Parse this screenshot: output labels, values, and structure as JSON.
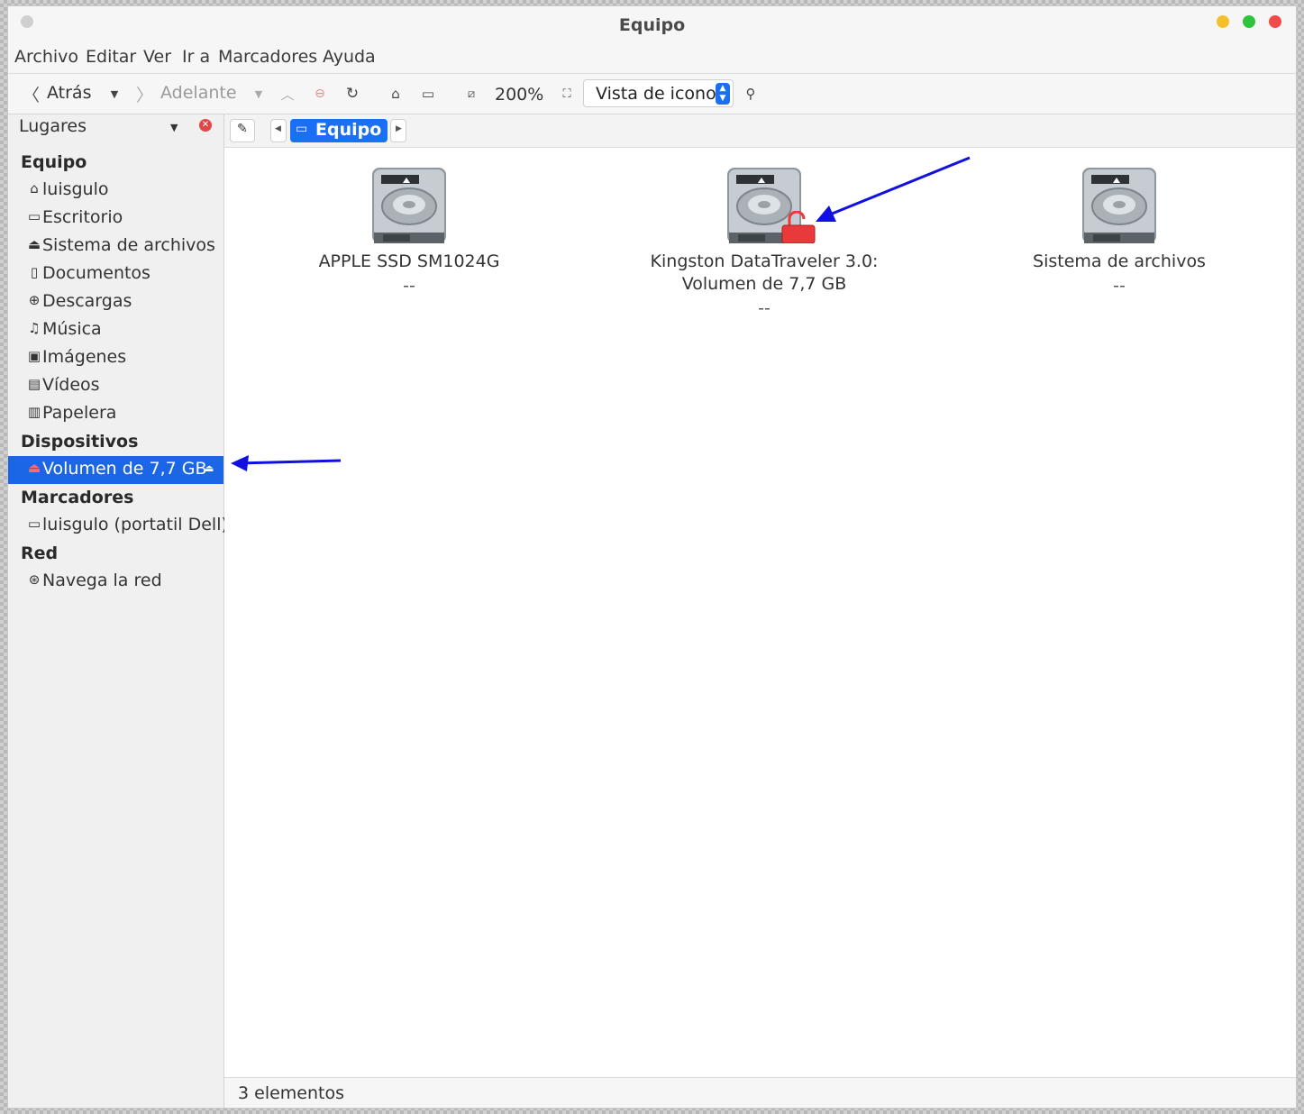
{
  "window": {
    "title": "Equipo",
    "buttons": {
      "minimize_color": "#f5c02a",
      "maximize_color": "#2ec43e",
      "close_color": "#f14a4a"
    }
  },
  "menubar": [
    "Archivo",
    "Editar",
    "Ver",
    "Ir a",
    "Marcadores",
    "Ayuda"
  ],
  "toolbar": {
    "back_label": "Atrás",
    "forward_label": "Adelante",
    "zoom": "200%",
    "view_mode": "Vista de icono"
  },
  "sidebar": {
    "header": "Lugares",
    "sections": [
      {
        "title": "Equipo",
        "items": [
          {
            "icon": "home-icon",
            "label": "luisgulo"
          },
          {
            "icon": "desktop-icon",
            "label": "Escritorio"
          },
          {
            "icon": "drive-icon",
            "label": "Sistema de archivos"
          },
          {
            "icon": "document-icon",
            "label": "Documentos"
          },
          {
            "icon": "download-icon",
            "label": "Descargas"
          },
          {
            "icon": "music-icon",
            "label": "Música"
          },
          {
            "icon": "image-icon",
            "label": "Imágenes"
          },
          {
            "icon": "video-icon",
            "label": "Vídeos"
          },
          {
            "icon": "trash-icon",
            "label": "Papelera"
          }
        ]
      },
      {
        "title": "Dispositivos",
        "items": [
          {
            "icon": "usb-drive-icon",
            "label": "Volumen de 7,7 GB",
            "selected": true,
            "eject": true
          }
        ]
      },
      {
        "title": "Marcadores",
        "items": [
          {
            "icon": "folder-icon",
            "label": "luisgulo (portatil Dell)"
          }
        ]
      },
      {
        "title": "Red",
        "items": [
          {
            "icon": "network-icon",
            "label": "Navega la red"
          }
        ]
      }
    ]
  },
  "pathbar": {
    "current": "Equipo"
  },
  "files": [
    {
      "name_line1": "APPLE SSD SM1024G",
      "name_line2": "",
      "size": "--",
      "locked": false
    },
    {
      "name_line1": "Kingston DataTraveler 3.0:",
      "name_line2": "Volumen de 7,7 GB",
      "size": "--",
      "locked": true
    },
    {
      "name_line1": "Sistema de archivos",
      "name_line2": "",
      "size": "--",
      "locked": false
    }
  ],
  "status": "3 elementos",
  "colors": {
    "accent": "#1a6ff5",
    "selection": "#1a66e6",
    "annotation_arrow": "#1010e0",
    "lock": "#e83a3a"
  }
}
